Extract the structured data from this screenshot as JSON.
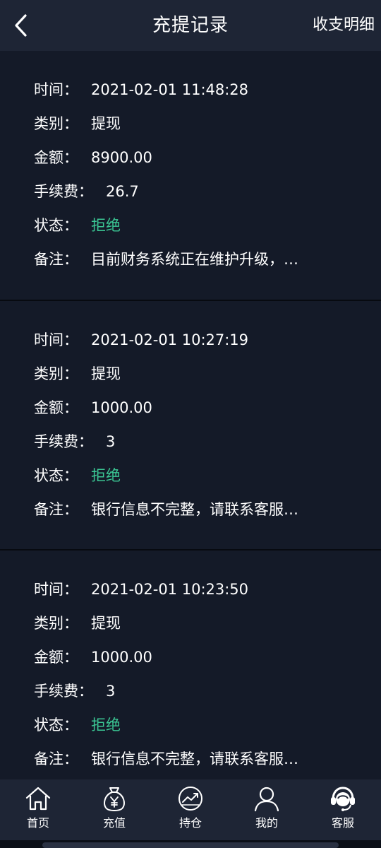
{
  "header": {
    "title": "充提记录",
    "detail_link": "收支明细"
  },
  "labels": {
    "time": "时间：",
    "type": "类别：",
    "amount": "金额：",
    "fee": "手续费：",
    "status": "状态：",
    "remark": "备注："
  },
  "records": [
    {
      "time": "2021-02-01 11:48:28",
      "type": "提现",
      "amount": "8900.00",
      "fee": "26.7",
      "status": "拒绝",
      "remark": "目前财务系统正在维护升级，…"
    },
    {
      "time": "2021-02-01 10:27:19",
      "type": "提现",
      "amount": "1000.00",
      "fee": "3",
      "status": "拒绝",
      "remark": "银行信息不完整，请联系客服…"
    },
    {
      "time": "2021-02-01 10:23:50",
      "type": "提现",
      "amount": "1000.00",
      "fee": "3",
      "status": "拒绝",
      "remark": "银行信息不完整，请联系客服…"
    }
  ],
  "tabbar": {
    "items": [
      {
        "label": "首页",
        "icon": "home-icon"
      },
      {
        "label": "充值",
        "icon": "money-bag-icon"
      },
      {
        "label": "持仓",
        "icon": "trend-chart-icon"
      },
      {
        "label": "我的",
        "icon": "user-icon"
      },
      {
        "label": "客服",
        "icon": "headset-icon"
      }
    ]
  },
  "colors": {
    "background": "#141a28",
    "bar": "#1e2535",
    "status_reject": "#3bc794",
    "text": "#ffffff"
  }
}
